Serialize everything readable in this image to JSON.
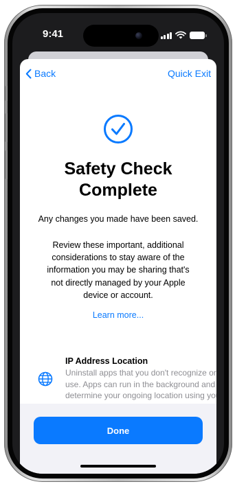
{
  "status_bar": {
    "time": "9:41",
    "icons": [
      "cellular-signal-icon",
      "wifi-icon",
      "battery-icon"
    ]
  },
  "nav": {
    "back_label": "Back",
    "back_icon": "chevron-left-icon",
    "quick_exit_label": "Quick Exit"
  },
  "hero": {
    "icon": "checkmark-circle-icon",
    "title": "Safety Check Complete",
    "subtitle": "Any changes you made have been saved.",
    "body": "Review these important, additional considerations to stay aware of the information you may be sharing that's not directly managed by your Apple device or account.",
    "learn_more_label": "Learn more..."
  },
  "considerations": [
    {
      "icon": "globe-icon",
      "title": "IP Address Location",
      "description": "Uninstall apps that you don't recognize or use. Apps can run in the background and determine your ongoing location using your IP address."
    }
  ],
  "footer": {
    "done_label": "Done"
  },
  "colors": {
    "accent": "#0a7aff",
    "secondary_text": "#8e8e93",
    "footer_bg": "#f2f2f7"
  }
}
